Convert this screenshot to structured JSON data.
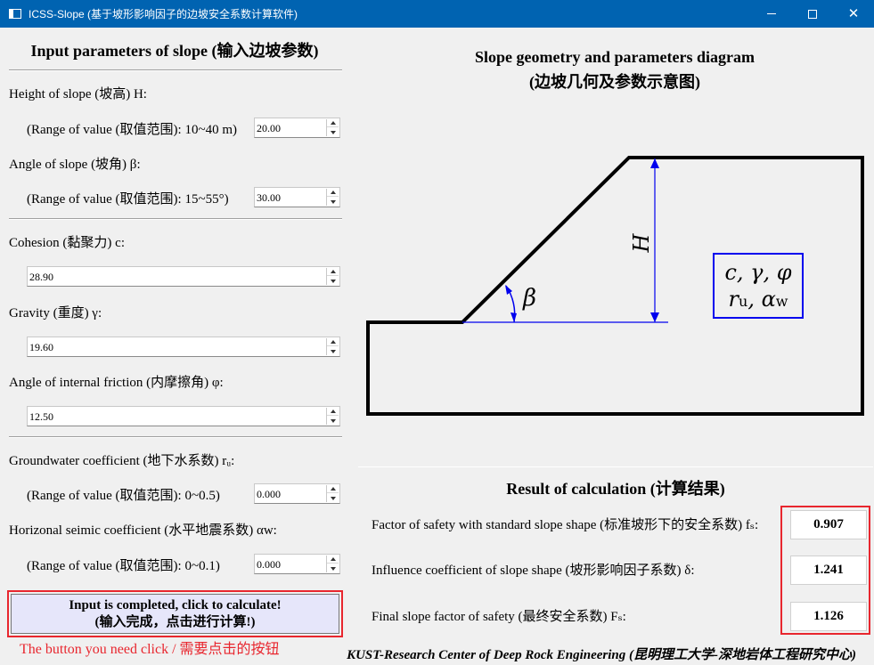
{
  "window": {
    "title": "ICSS-Slope (基于坡形影响因子的边坡安全系数计算软件)"
  },
  "left": {
    "heading": "Input parameters of slope (输入边坡参数)",
    "height_label": "Height of slope (坡高) H:",
    "height_range": "(Range of value (取值范围): 10~40 m)",
    "height_value": "20.00",
    "angle_label": "Angle of slope (坡角) β:",
    "angle_range": "(Range of value (取值范围): 15~55°)",
    "angle_value": "30.00",
    "cohesion_label": "Cohesion (黏聚力) c:",
    "cohesion_value": "28.90",
    "gravity_label": "Gravity (重度) γ:",
    "gravity_value": "19.60",
    "friction_label": "Angle of internal friction (内摩擦角) φ:",
    "friction_value": "12.50",
    "groundwater_label": "Groundwater coefficient (地下水系数) rᵤ:",
    "groundwater_range": "(Range of value (取值范围): 0~0.5)",
    "groundwater_value": "0.000",
    "seismic_label": "Horizonal seimic coefficient (水平地震系数) αw:",
    "seismic_range": "(Range of value (取值范围): 0~0.1)",
    "seismic_value": "0.000",
    "calc_button_line1": "Input is completed, click to calculate!",
    "calc_button_line2": "(输入完成，点击进行计算!)",
    "hint": "The button you need click / 需要点击的按钮"
  },
  "diagram": {
    "title_line1": "Slope geometry and parameters diagram",
    "title_line2": "(边坡几何及参数示意图)",
    "h_symbol": "H",
    "beta_symbol": "β",
    "params_line1": "c, γ, φ",
    "params_line2_r": "r",
    "params_line2_r_sub": "u",
    "params_line2_alpha": ", α",
    "params_line2_alpha_sub": "w"
  },
  "results": {
    "heading": "Result of calculation (计算结果)",
    "fs_label": "Factor of safety with standard slope shape (标准坡形下的安全系数) fₛ:",
    "fs_value": "0.907",
    "delta_label": "Influence coefficient of slope shape (坡形影响因子系数) δ:",
    "delta_value": "1.241",
    "final_label": "Final slope factor of safety (最终安全系数) Fₛ:",
    "final_value": "1.126"
  },
  "footer": {
    "text": "KUST-Research Center of Deep Rock Engineering (昆明理工大学-深地岩体工程研究中心)"
  },
  "colors": {
    "titlebar": "#0063b1",
    "accent_red": "#e8262e",
    "button_bg": "#e6e6fa",
    "diagram_blue": "#0000ee"
  }
}
